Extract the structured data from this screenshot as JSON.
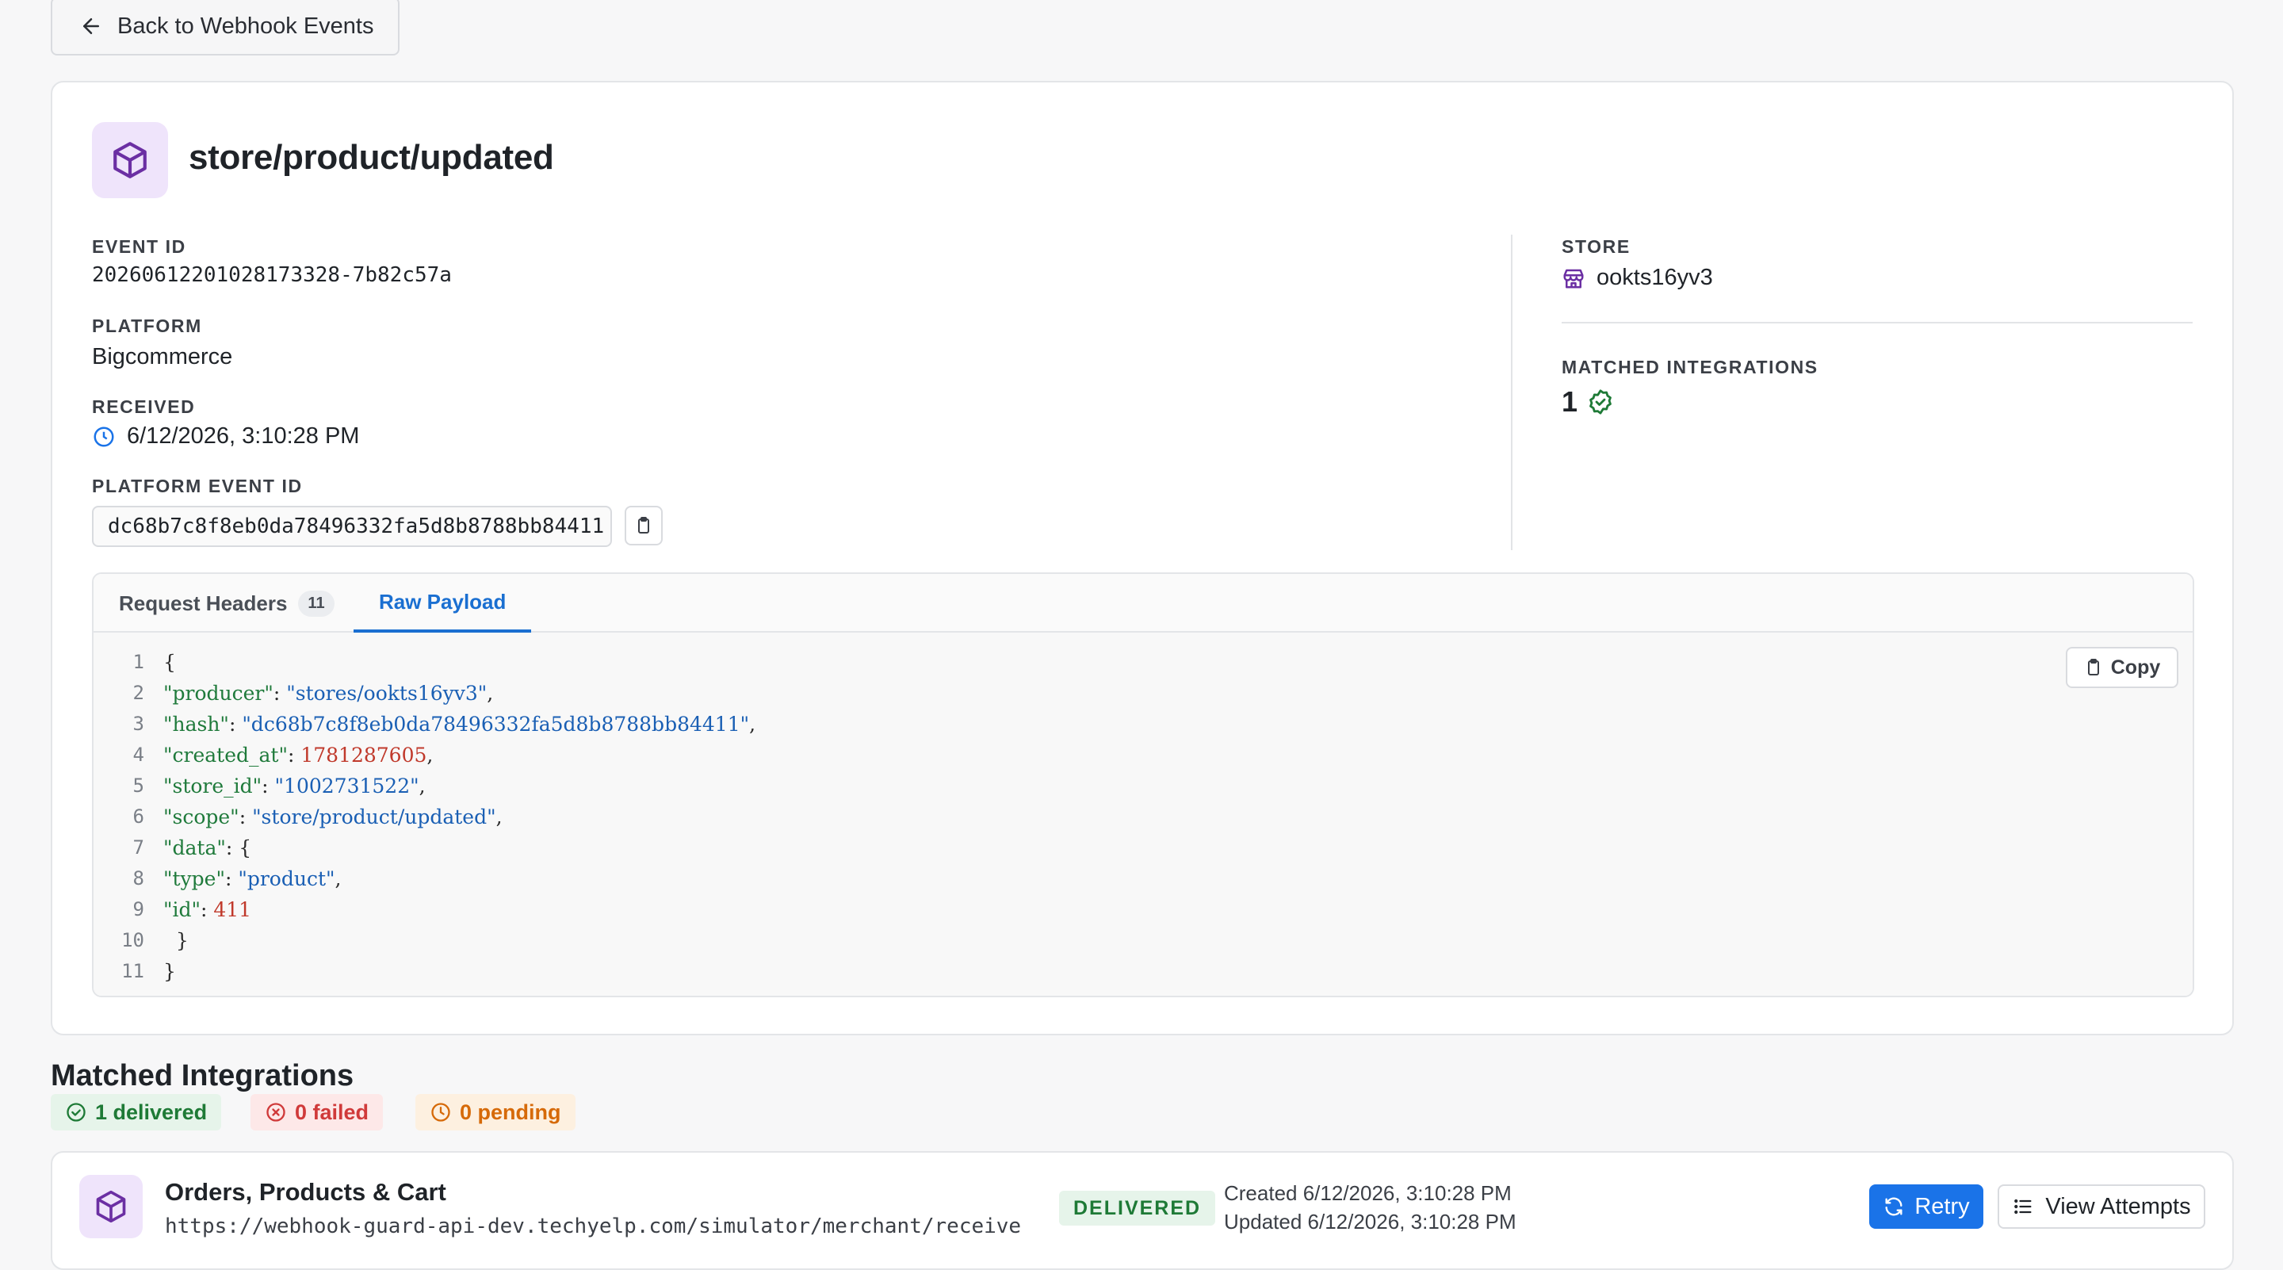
{
  "nav": {
    "back_label": "Back to Webhook Events"
  },
  "event": {
    "title": "store/product/updated",
    "event_id_label": "EVENT ID",
    "event_id": "20260612201028173328-7b82c57a",
    "platform_label": "PLATFORM",
    "platform": "Bigcommerce",
    "received_label": "RECEIVED",
    "received": "6/12/2026, 3:10:28 PM",
    "platform_event_id_label": "PLATFORM EVENT ID",
    "platform_event_id": "dc68b7c8f8eb0da78496332fa5d8b8788bb84411",
    "store_label": "STORE",
    "store": "ookts16yv3",
    "matched_label": "MATCHED INTEGRATIONS",
    "matched_count": "1"
  },
  "tabs": {
    "headers_label": "Request Headers",
    "headers_count": "11",
    "payload_label": "Raw Payload",
    "copy_label": "Copy"
  },
  "payload_lines": [
    {
      "n": "1"
    },
    {
      "n": "2"
    },
    {
      "n": "3"
    },
    {
      "n": "4"
    },
    {
      "n": "5"
    },
    {
      "n": "6"
    },
    {
      "n": "7"
    },
    {
      "n": "8"
    },
    {
      "n": "9"
    },
    {
      "n": "10"
    },
    {
      "n": "11"
    }
  ],
  "payload": {
    "producer_key": "\"producer\"",
    "producer_val": "\"stores/ookts16yv3\"",
    "hash_key": "\"hash\"",
    "hash_val": "\"dc68b7c8f8eb0da78496332fa5d8b8788bb84411\"",
    "created_key": "\"created_at\"",
    "created_val": "1781287605",
    "store_key": "\"store_id\"",
    "store_val": "\"1002731522\"",
    "scope_key": "\"scope\"",
    "scope_val": "\"store/product/updated\"",
    "data_key": "\"data\"",
    "type_key": "\"type\"",
    "type_val": "\"product\"",
    "id_key": "\"id\"",
    "id_val": "411"
  },
  "matched_section": {
    "title": "Matched Integrations",
    "delivered": "1 delivered",
    "failed": "0 failed",
    "pending": "0 pending"
  },
  "integration": {
    "name": "Orders, Products & Cart",
    "url": "https://webhook-guard-api-dev.techyelp.com/simulator/merchant/receive",
    "status": "DELIVERED",
    "created": "Created 6/12/2026, 3:10:28 PM",
    "updated": "Updated 6/12/2026, 3:10:28 PM",
    "retry_label": "Retry",
    "attempts_label": "View Attempts"
  },
  "colors": {
    "accent": "#1a73e8",
    "success": "#1e7a36",
    "danger": "#d03a3a",
    "warning": "#d66a09",
    "icon_purple": "#6b2fa3"
  }
}
